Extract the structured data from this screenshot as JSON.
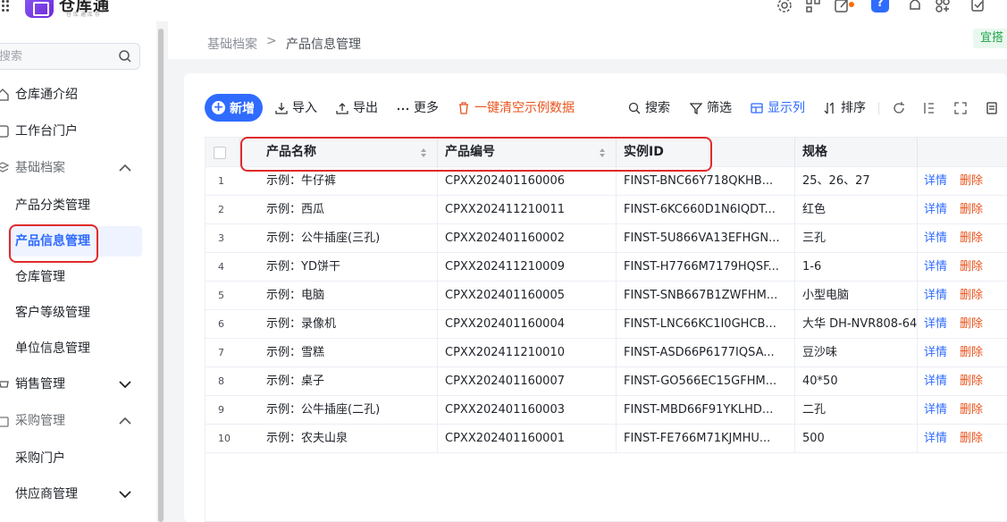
{
  "app": {
    "title": "仓库通",
    "subtitle": "仓库通库存"
  },
  "topbar": {
    "icons": [
      "settings-icon",
      "scan-icon",
      "edit-icon",
      "help-icon",
      "bell-icon",
      "apps-icon",
      "todo-icon"
    ],
    "help_label": "?"
  },
  "sidebar": {
    "search_placeholder": "搜索",
    "items": [
      {
        "label": "仓库通介绍",
        "icon": "home-icon"
      },
      {
        "label": "工作台门户",
        "icon": "workbench-icon"
      },
      {
        "label": "基础档案",
        "icon": "archive-icon",
        "expanded": true
      },
      {
        "label": "产品分类管理"
      },
      {
        "label": "产品信息管理",
        "active": true
      },
      {
        "label": "仓库管理"
      },
      {
        "label": "客户等级管理"
      },
      {
        "label": "单位信息管理"
      },
      {
        "label": "销售管理",
        "icon": "sales-icon",
        "expanded": false
      },
      {
        "label": "采购管理",
        "icon": "purchase-icon",
        "expanded": true
      },
      {
        "label": "采购门户"
      },
      {
        "label": "供应商管理",
        "expanded": false
      }
    ]
  },
  "breadcrumb": {
    "parent": "基础档案",
    "separator": ">",
    "current": "产品信息管理"
  },
  "badge": "宜搭",
  "toolbar": {
    "add": "新增",
    "import": "导入",
    "export": "导出",
    "more": "更多",
    "clear": "一键清空示例数据",
    "search": "搜索",
    "filter": "筛选",
    "columns": "显示列",
    "sort": "排序"
  },
  "table": {
    "headers": {
      "name": "产品名称",
      "code": "产品编号",
      "instance_id": "实例ID",
      "spec": "规格"
    },
    "action_detail": "详情",
    "action_delete": "删除",
    "rows": [
      {
        "idx": "1",
        "name": "示例：牛仔裤",
        "code": "CPXX202401160006",
        "instance_id": "FINST-BNC66Y718QKHB...",
        "spec": "25、26、27"
      },
      {
        "idx": "2",
        "name": "示例：西瓜",
        "code": "CPXX202411210011",
        "instance_id": "FINST-6KC660D1N6IQDT...",
        "spec": "红色"
      },
      {
        "idx": "3",
        "name": "示例：公牛插座(三孔)",
        "code": "CPXX202401160002",
        "instance_id": "FINST-5U866VA13EFHGN...",
        "spec": "三孔"
      },
      {
        "idx": "4",
        "name": "示例：YD饼干",
        "code": "CPXX202411210009",
        "instance_id": "FINST-H7766M7179HQSF...",
        "spec": "1-6"
      },
      {
        "idx": "5",
        "name": "示例：电脑",
        "code": "CPXX202401160005",
        "instance_id": "FINST-SNB667B1ZWFHM...",
        "spec": "小型电脑"
      },
      {
        "idx": "6",
        "name": "示例：录像机",
        "code": "CPXX202401160004",
        "instance_id": "FINST-LNC66KC1I0GHCB...",
        "spec": "大华 DH-NVR808-64"
      },
      {
        "idx": "7",
        "name": "示例：雪糕",
        "code": "CPXX202411210010",
        "instance_id": "FINST-ASD66P6177IQSA...",
        "spec": "豆沙味"
      },
      {
        "idx": "8",
        "name": "示例：桌子",
        "code": "CPXX202401160007",
        "instance_id": "FINST-GO566EC15GFHM...",
        "spec": "40*50"
      },
      {
        "idx": "9",
        "name": "示例：公牛插座(二孔)",
        "code": "CPXX202401160003",
        "instance_id": "FINST-MBD66F91YKLHD...",
        "spec": "二孔"
      },
      {
        "idx": "10",
        "name": "示例：农夫山泉",
        "code": "CPXX202401160001",
        "instance_id": "FINST-FE766M71KJMHU...",
        "spec": "500"
      }
    ]
  },
  "colors": {
    "primary": "#2f6bff",
    "danger": "#e8541e",
    "annotation": "#e02b2b"
  }
}
